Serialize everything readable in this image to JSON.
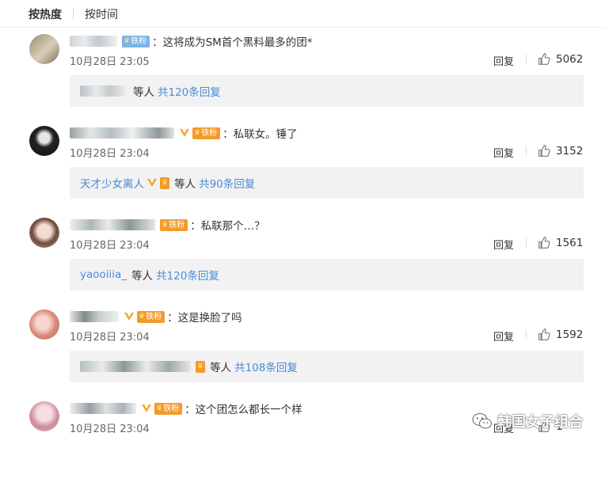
{
  "sort": {
    "hot": "按热度",
    "time": "按时间"
  },
  "comments": [
    {
      "badge": "铁粉",
      "badge_color": "blue",
      "vip": false,
      "text": "：这将成为SM首个黑料最多的团*",
      "date": "10月28日 23:05",
      "reply": "回复",
      "likes": "5062",
      "replies": {
        "name": "",
        "etc": "等人",
        "count": "共120条回复",
        "vip": false,
        "crown": false
      }
    },
    {
      "badge": "铁粉",
      "badge_color": "orange",
      "vip": true,
      "text": "：私联女。锤了",
      "date": "10月28日 23:04",
      "reply": "回复",
      "likes": "3152",
      "replies": {
        "name": "天才少女离人",
        "etc": "等人",
        "count": "共90条回复",
        "vip": true,
        "crown": true
      }
    },
    {
      "badge": "铁粉",
      "badge_color": "orange",
      "vip": false,
      "text": "：私联那个…？",
      "date": "10月28日 23:04",
      "reply": "回复",
      "likes": "1561",
      "replies": {
        "name": "yaooiiia_",
        "etc": "等人",
        "count": "共120条回复",
        "vip": false,
        "crown": false
      }
    },
    {
      "badge": "铁粉",
      "badge_color": "orange",
      "vip": true,
      "text": "：这是换脸了吗",
      "date": "10月28日 23:04",
      "reply": "回复",
      "likes": "1592",
      "replies": {
        "name": "",
        "etc": "等人",
        "count": "共108条回复",
        "vip": false,
        "crown": true
      }
    },
    {
      "badge": "铁粉",
      "badge_color": "orange",
      "vip": true,
      "text": "：这个团怎么都长一个样",
      "date": "10月28日 23:04",
      "reply": "回复",
      "likes": "1",
      "replies": null
    }
  ],
  "watermark": "韩国女子组合",
  "colors": {
    "link": "#4a8bd6",
    "fan_badge": "#f49a2c",
    "fan_badge_blue": "#7cb3e8",
    "vip": "#f5a623",
    "reply_bg": "#f2f2f2"
  },
  "icons": {
    "like": "thumb-up-icon",
    "vip": "vip-v-icon",
    "watermark": "wechat-icon"
  }
}
